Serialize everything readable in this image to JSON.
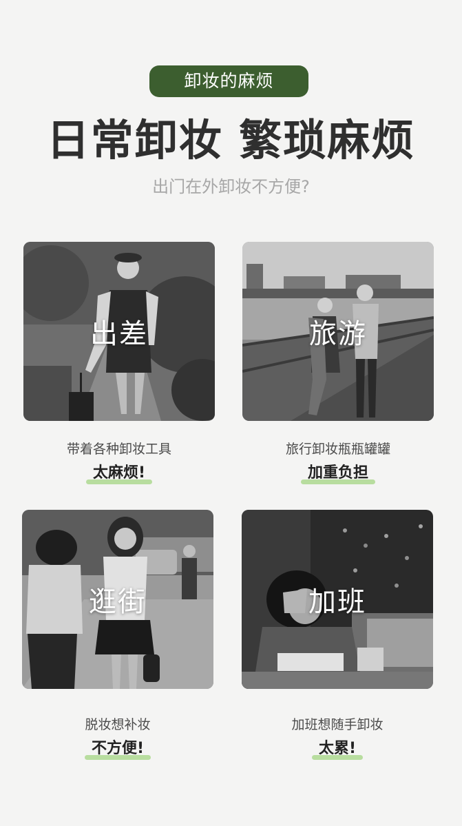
{
  "header": {
    "badge_label": "卸妆的麻烦",
    "headline": "日常卸妆 繁琐麻烦",
    "subhead": "出门在外卸妆不方便?"
  },
  "cards": [
    {
      "label": "出差",
      "caption": "带着各种卸妆工具",
      "emphasis": "太麻烦!"
    },
    {
      "label": "旅游",
      "caption": "旅行卸妆瓶瓶罐罐",
      "emphasis": "加重负担"
    },
    {
      "label": "逛街",
      "caption": "脱妆想补妆",
      "emphasis": "不方便!"
    },
    {
      "label": "加班",
      "caption": "加班想随手卸妆",
      "emphasis": "太累!"
    }
  ],
  "colors": {
    "badge_background": "#3c5e2f",
    "emphasis_underline": "#b8dd9f",
    "page_background": "#f4f4f3"
  }
}
